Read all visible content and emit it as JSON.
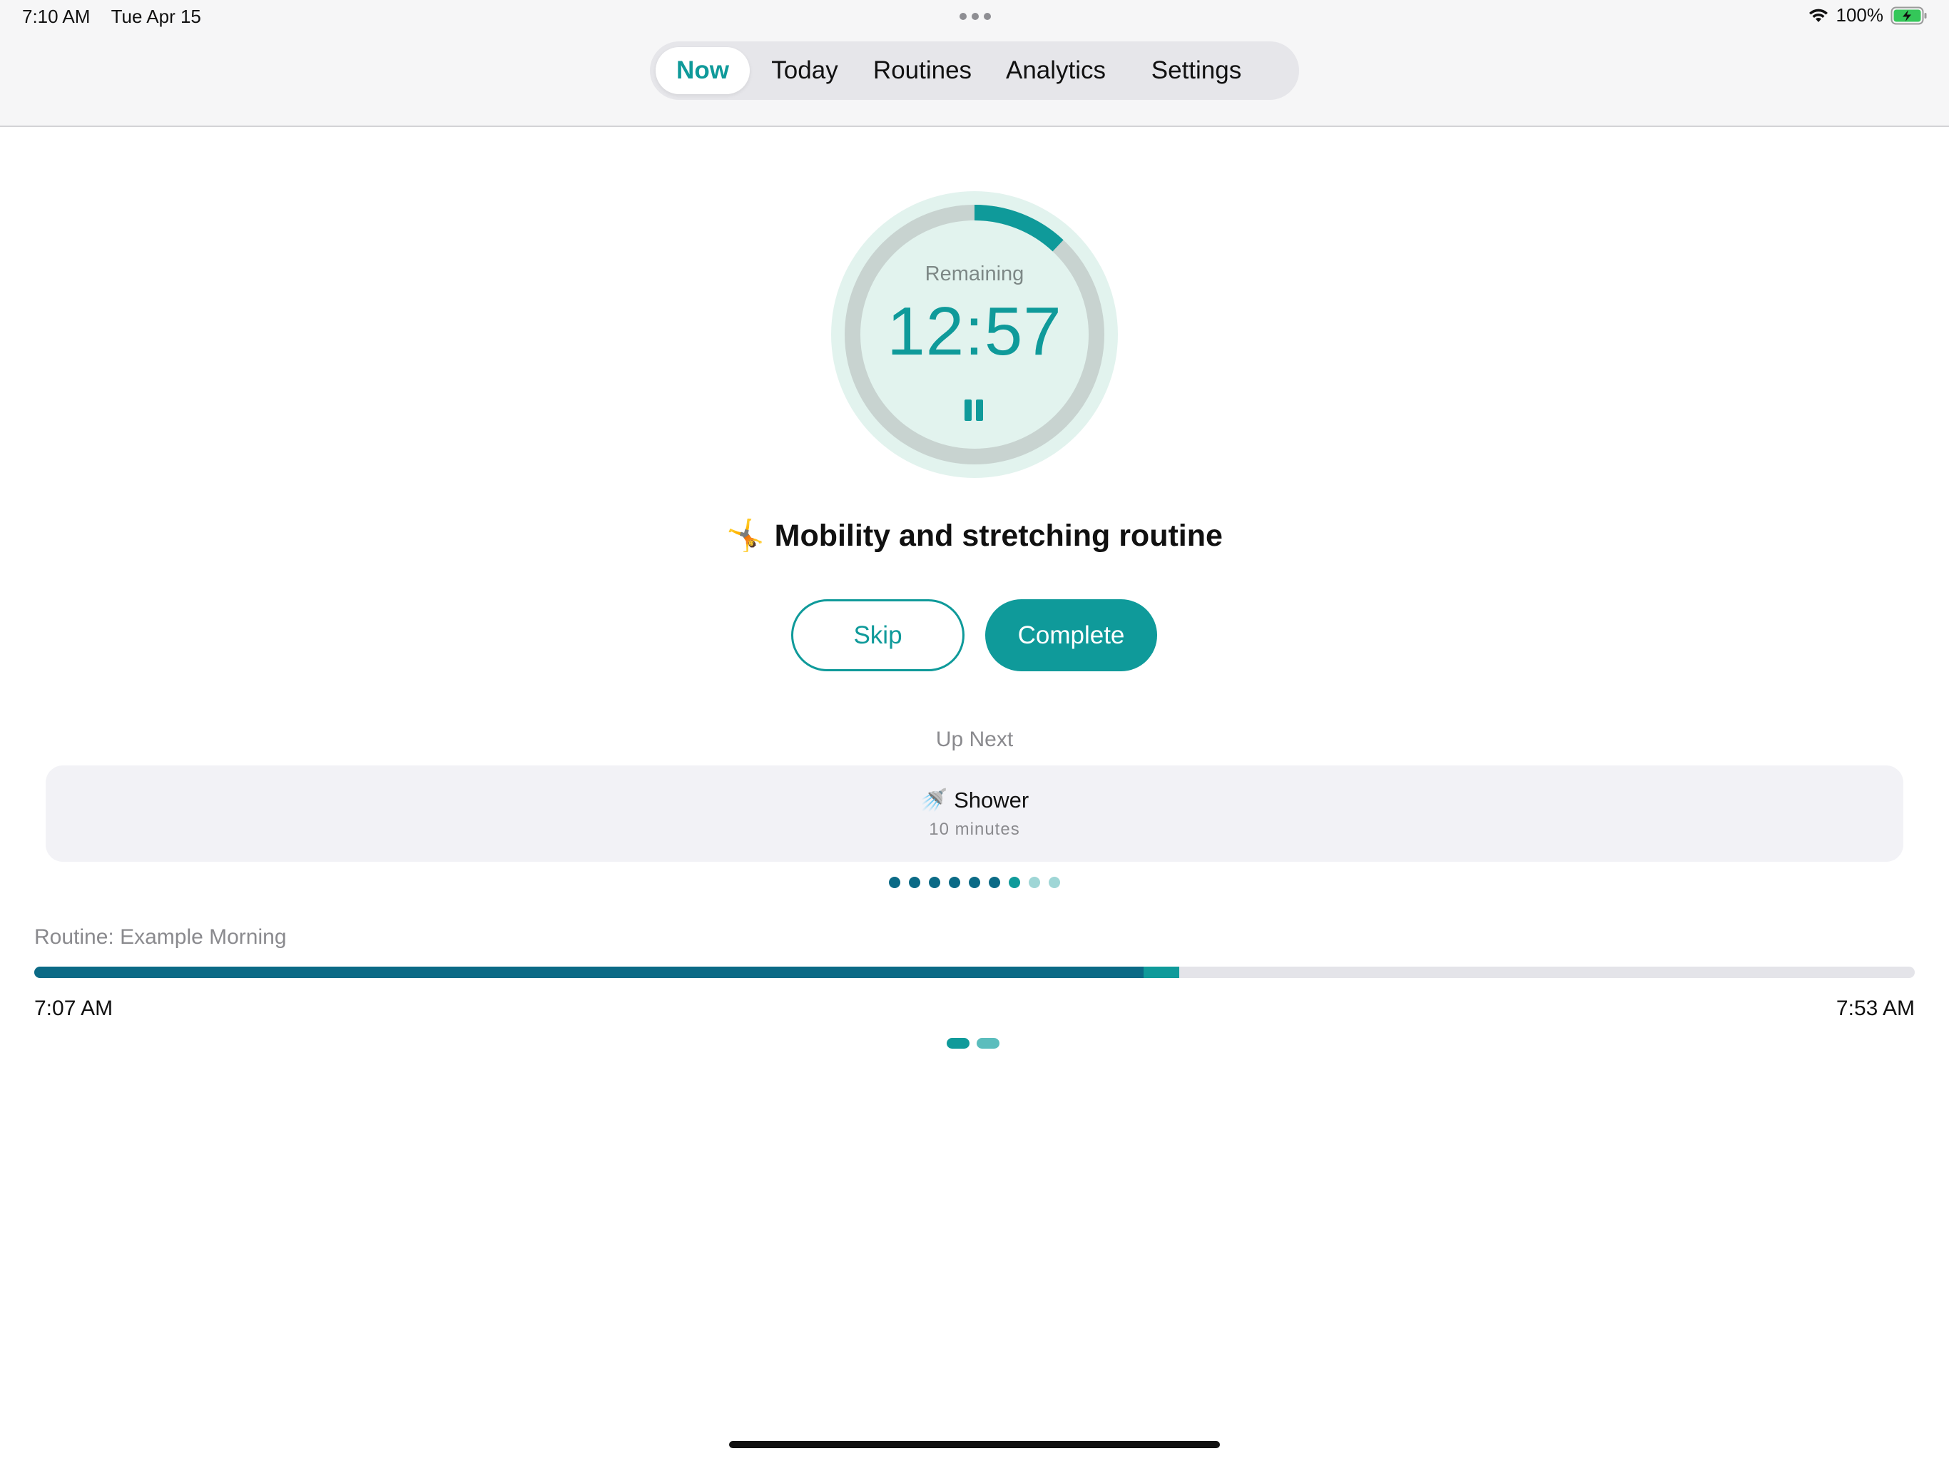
{
  "status_bar": {
    "time": "7:10 AM",
    "date": "Tue Apr 15",
    "battery": "100%"
  },
  "tabs": [
    {
      "label": "Now",
      "active": true
    },
    {
      "label": "Today",
      "active": false
    },
    {
      "label": "Routines",
      "active": false
    },
    {
      "label": "Analytics",
      "active": false
    },
    {
      "label": "Settings",
      "active": false
    }
  ],
  "timer": {
    "label": "Remaining",
    "value": "12:57",
    "progress_fraction": 0.12
  },
  "current_task": {
    "emoji": "🤸",
    "title": "Mobility and stretching routine"
  },
  "actions": {
    "skip_label": "Skip",
    "complete_label": "Complete"
  },
  "up_next": {
    "label": "Up Next",
    "emoji": "🚿",
    "title": "Shower",
    "duration": "10 minutes"
  },
  "task_dots": {
    "total": 9,
    "completed": 6,
    "current_index": 6
  },
  "routine": {
    "label": "Routine: Example Morning",
    "start_time": "7:07 AM",
    "end_time": "7:53 AM",
    "completed_fraction": 0.59,
    "current_fraction": 0.019
  },
  "pager": {
    "pages": 2,
    "active": 0
  },
  "colors": {
    "accent": "#0f9a9a",
    "done": "#0b6a86",
    "ring_bg": "#e2f3ee",
    "ring_track": "#c8d3d0",
    "pending_dot": "#9fd6d6"
  }
}
